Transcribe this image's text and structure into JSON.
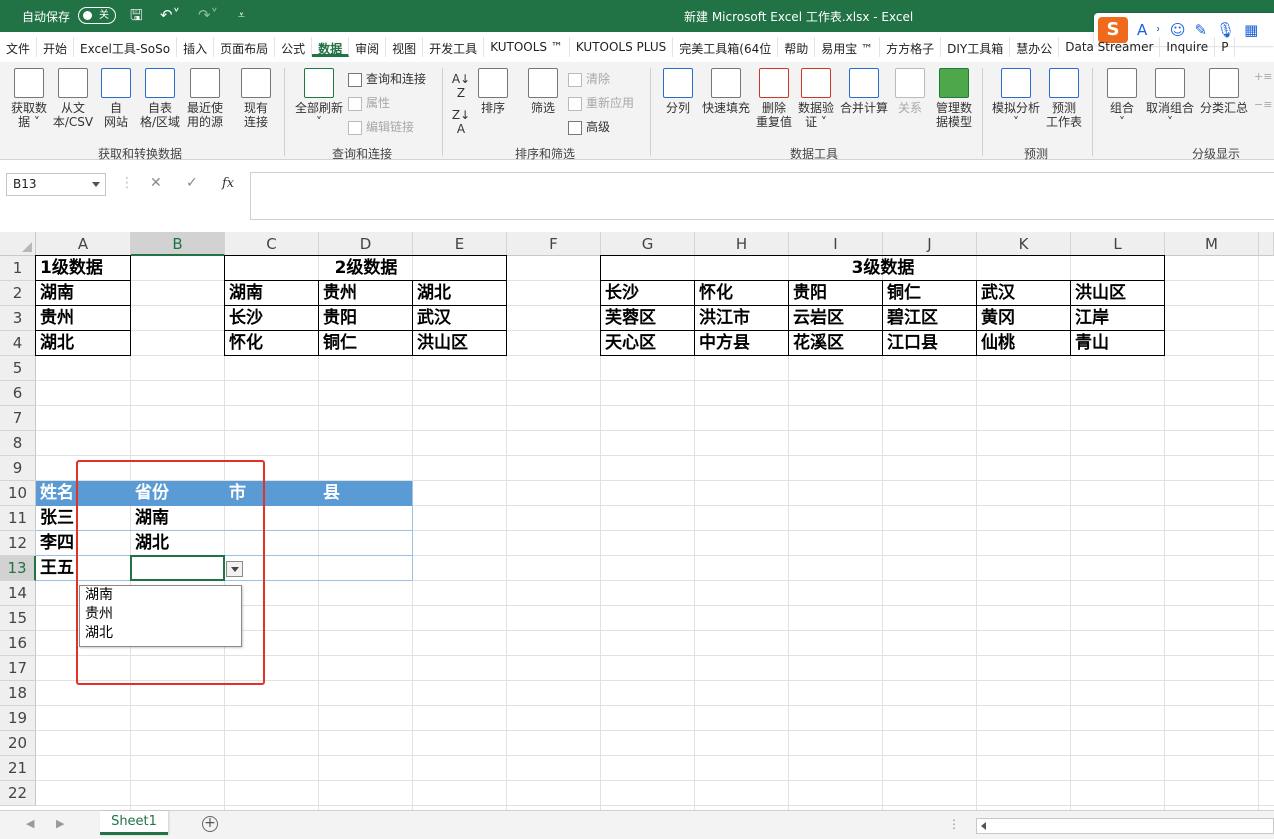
{
  "titlebar": {
    "autosave_label": "自动保存",
    "autosave_state": "关",
    "title": "新建 Microsoft Excel 工作表.xlsx  -  Excel"
  },
  "tabs": [
    "文件",
    "开始",
    "Excel工具-SoSo",
    "插入",
    "页面布局",
    "公式",
    "数据",
    "审阅",
    "视图",
    "开发工具",
    "KUTOOLS ™",
    "KUTOOLS PLUS",
    "完美工具箱(64位",
    "帮助",
    "易用宝 ™",
    "方方格子",
    "DIY工具箱",
    "慧办公",
    "Data Streamer",
    "Inquire",
    "P"
  ],
  "active_tab": "数据",
  "ribbon": {
    "get_data": "获取数\n据 ˅",
    "from_text": "从文\n本/CSV",
    "from_web": "自\n网站",
    "from_table": "自表\n格/区域",
    "recent_sources": "最近使\n用的源",
    "existing_conn": "现有\n连接",
    "group_get": "获取和转换数据",
    "refresh_all": "全部刷新\n˅",
    "queries_conn": "查询和连接",
    "properties": "属性",
    "edit_links": "编辑链接",
    "group_query": "查询和连接",
    "sort": "排序",
    "filter": "筛选",
    "clear": "清除",
    "reapply": "重新应用",
    "advanced": "高级",
    "group_sort": "排序和筛选",
    "text_to_col": "分列",
    "flash_fill": "快速填充",
    "remove_dup": "删除\n重复值",
    "data_valid": "数据验\n证 ˅",
    "consolidate": "合并计算",
    "relations": "关系",
    "manage_model": "管理数\n据模型",
    "group_tools": "数据工具",
    "what_if": "模拟分析\n˅",
    "forecast": "预测\n工作表",
    "group_forecast": "预测",
    "group_btn": "组合\n˅",
    "ungroup": "取消组合\n˅",
    "subtotal": "分类汇总",
    "group_outline": "分级显示"
  },
  "formula_bar": {
    "name_box": "B13",
    "cancel_symbol": "✕",
    "enter_symbol": "✓",
    "fx": "fx",
    "value": ""
  },
  "columns": [
    "A",
    "B",
    "C",
    "D",
    "E",
    "F",
    "G",
    "H",
    "I",
    "J",
    "K",
    "L",
    "M"
  ],
  "rows": [
    "1",
    "2",
    "3",
    "4",
    "5",
    "6",
    "7",
    "8",
    "9",
    "10",
    "11",
    "12",
    "13",
    "14",
    "15",
    "16",
    "17",
    "18",
    "19",
    "20",
    "21",
    "22"
  ],
  "cells": {
    "a1": "1级数据",
    "a2": "湖南",
    "a3": "贵州",
    "a4": "湖北",
    "c1": "2级数据",
    "c2": "湖南",
    "d2": "贵州",
    "e2": "湖北",
    "c3": "长沙",
    "d3": "贵阳",
    "e3": "武汉",
    "c4": "怀化",
    "d4": "铜仁",
    "e4": "洪山区",
    "g1": "3级数据",
    "g2": "长沙",
    "h2": "怀化",
    "i2": "贵阳",
    "j2": "铜仁",
    "k2": "武汉",
    "l2": "洪山区",
    "g3": "芙蓉区",
    "h3": "洪江市",
    "i3": "云岩区",
    "j3": "碧江区",
    "k3": "黄冈",
    "l3": "江岸",
    "g4": "天心区",
    "h4": "中方县",
    "i4": "花溪区",
    "j4": "江口县",
    "k4": "仙桃",
    "l4": "青山",
    "a10": "姓名",
    "b10": "省份",
    "c10": "市",
    "d10": "县",
    "a11": "张三",
    "b11": "湖南",
    "a12": "李四",
    "b12": "湖北",
    "a13": "王五"
  },
  "dropdown_options": [
    "湖南",
    "贵州",
    "湖北"
  ],
  "sheet_tabs": [
    "Sheet1"
  ],
  "colors": {
    "excel_green": "#217346",
    "table_header": "#5b9bd5",
    "highlight_red": "#e23227"
  }
}
